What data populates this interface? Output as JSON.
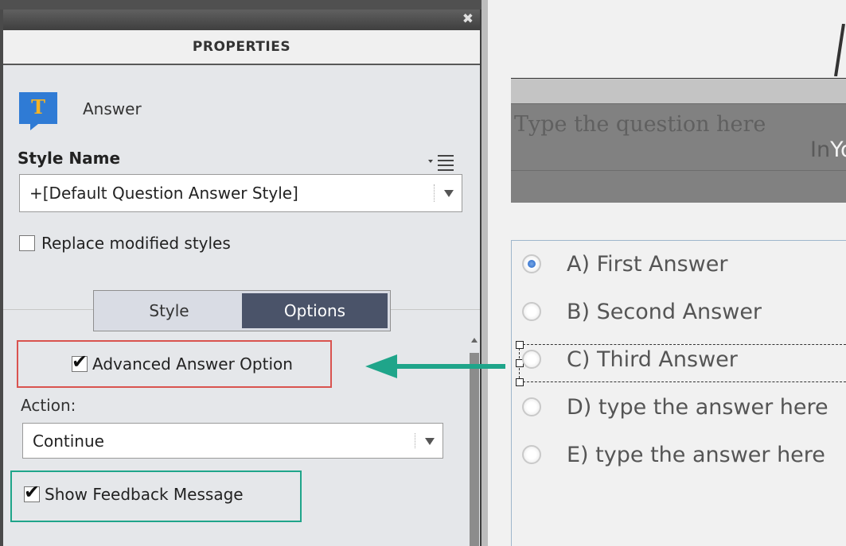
{
  "panel": {
    "title": "PROPERTIES",
    "close_glyph": "✖",
    "object_icon_glyph": "T",
    "object_name": "Answer",
    "style_name_label": "Style Name",
    "style_dropdown_value": "+[Default Question Answer Style]",
    "replace_styles_label": "Replace modified styles",
    "replace_styles_checked": false,
    "tabs": [
      {
        "label": "Style",
        "active": false
      },
      {
        "label": "Options",
        "active": true
      }
    ],
    "advanced_option_label": "Advanced Answer Option",
    "advanced_option_checked": true,
    "action_label": "Action:",
    "action_value": "Continue",
    "feedback_label": "Show Feedback Message",
    "feedback_checked": true,
    "check_glyph": "✔"
  },
  "canvas": {
    "question_placeholder": "Type the question here",
    "overflow_text_dark": "In",
    "overflow_text_light": "Yo",
    "answers": [
      {
        "label": "A) First Answer",
        "selected": true
      },
      {
        "label": "B) Second Answer",
        "selected": false
      },
      {
        "label": "C) Third Answer",
        "selected": false
      },
      {
        "label": "D) type the answer here",
        "selected": false
      },
      {
        "label": "E) type the answer here",
        "selected": false
      }
    ]
  },
  "colors": {
    "active_tab": "#4a5369",
    "highlight_red": "#d9534f",
    "highlight_green": "#1fa58a",
    "arrow": "#1fa58a",
    "icon_bg": "#2f7bd5",
    "icon_letter": "#f5b324"
  }
}
